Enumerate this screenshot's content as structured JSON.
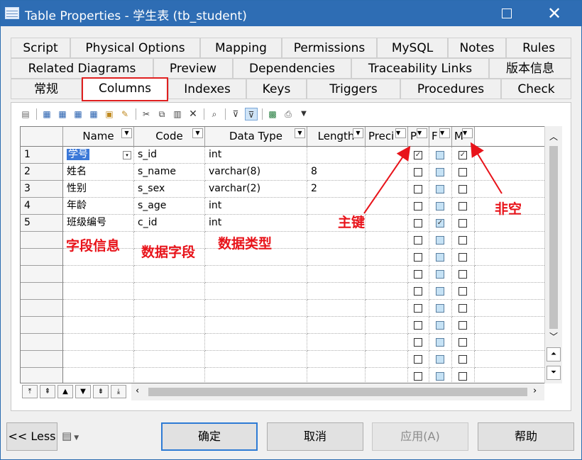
{
  "window": {
    "title": "Table Properties - 学生表 (tb_student)"
  },
  "tabs": {
    "row1": [
      "Script",
      "Physical Options",
      "Mapping",
      "Permissions",
      "MySQL",
      "Notes",
      "Rules"
    ],
    "row2": [
      "Related Diagrams",
      "Preview",
      "Dependencies",
      "Traceability Links",
      "版本信息"
    ],
    "row3": [
      "常规",
      "Columns",
      "Indexes",
      "Keys",
      "Triggers",
      "Procedures",
      "Check"
    ],
    "active": "Columns"
  },
  "grid": {
    "headers": [
      "Name",
      "Code",
      "Data Type",
      "Length",
      "Preci",
      "P",
      "F",
      "M"
    ],
    "rows": [
      {
        "num": "1",
        "name": "学号",
        "code": "s_id",
        "type": "int",
        "length": "",
        "p": true,
        "f": false,
        "m": true
      },
      {
        "num": "2",
        "name": "姓名",
        "code": "s_name",
        "type": "varchar(8)",
        "length": "8",
        "p": false,
        "f": false,
        "m": false
      },
      {
        "num": "3",
        "name": "性别",
        "code": "s_sex",
        "type": "varchar(2)",
        "length": "2",
        "p": false,
        "f": false,
        "m": false
      },
      {
        "num": "4",
        "name": "年龄",
        "code": "s_age",
        "type": "int",
        "length": "",
        "p": false,
        "f": false,
        "m": false
      },
      {
        "num": "5",
        "name": "班级编号",
        "code": "c_id",
        "type": "int",
        "length": "",
        "p": false,
        "f": true,
        "m": false
      }
    ]
  },
  "annotations": {
    "field_info": "字段信息",
    "data_field": "数据字段",
    "data_type": "数据类型",
    "primary_key": "主键",
    "not_null": "非空"
  },
  "footer": {
    "less": "<< Less",
    "ok": "确定",
    "cancel": "取消",
    "apply": "应用(A)",
    "help": "帮助"
  },
  "colors": {
    "title_bar": "#2e6db4",
    "annotation": "#e8131a",
    "active_tab_border": "#e02020",
    "selection": "#3b78d8"
  }
}
